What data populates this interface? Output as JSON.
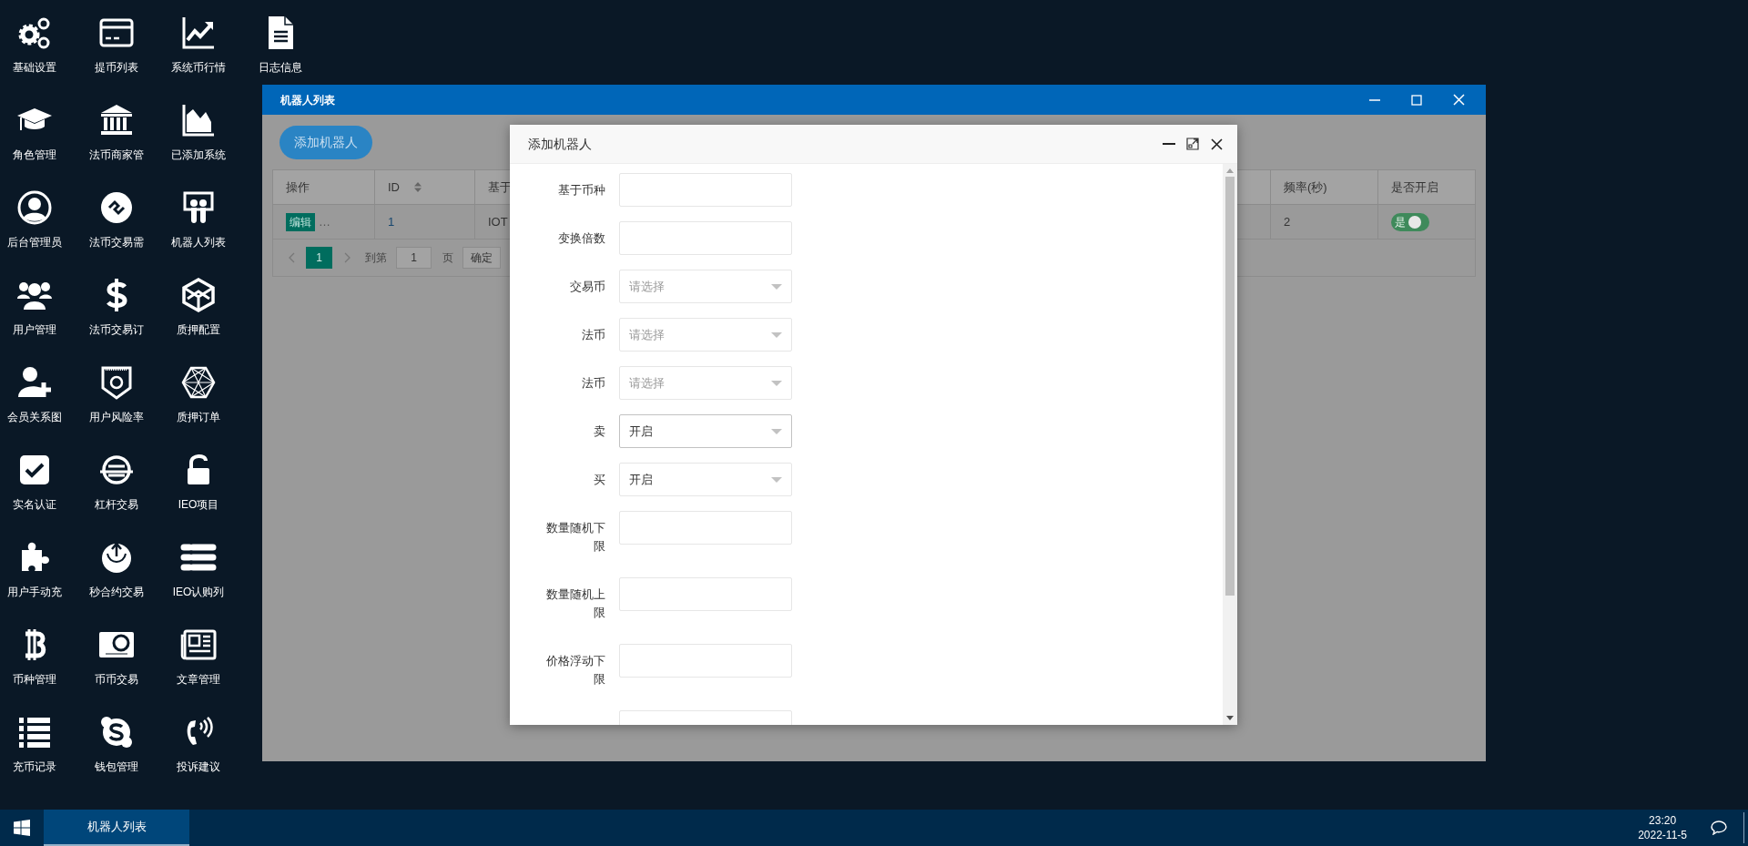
{
  "desktop_icons": [
    {
      "label": "基础设置"
    },
    {
      "label": "角色管理"
    },
    {
      "label": "后台管理员"
    },
    {
      "label": "用户管理"
    },
    {
      "label": "会员关系图"
    },
    {
      "label": "实名认证"
    },
    {
      "label": "用户手动充"
    },
    {
      "label": "币种管理"
    },
    {
      "label": "充币记录"
    },
    {
      "label": "提币列表"
    },
    {
      "label": "法币商家管"
    },
    {
      "label": "法币交易需"
    },
    {
      "label": "法币交易订"
    },
    {
      "label": "用户风险率"
    },
    {
      "label": "杠杆交易"
    },
    {
      "label": "秒合约交易"
    },
    {
      "label": "币币交易"
    },
    {
      "label": "钱包管理"
    },
    {
      "label": "系统币行情"
    },
    {
      "label": "已添加系统"
    },
    {
      "label": "机器人列表"
    },
    {
      "label": "质押配置"
    },
    {
      "label": "质押订单"
    },
    {
      "label": "IEO项目"
    },
    {
      "label": "IEO认购列"
    },
    {
      "label": "文章管理"
    },
    {
      "label": "投诉建议"
    },
    {
      "label": "日志信息"
    }
  ],
  "window": {
    "title": "机器人列表",
    "add_button": "添加机器人",
    "table": {
      "columns": [
        {
          "label": "操作",
          "sortable": false
        },
        {
          "label": "ID",
          "sortable": true
        },
        {
          "label": "基于",
          "sortable": false
        },
        {
          "label": "频率(秒)",
          "sortable": false
        },
        {
          "label": "是否开启",
          "sortable": false
        }
      ],
      "rows": [
        {
          "action": "编辑",
          "more": "…",
          "id": "1",
          "column_3": "IOT",
          "frequency": "2",
          "enabled": true,
          "enabled_label": "是"
        }
      ]
    },
    "pagination": {
      "pages": [
        {
          "label": "1",
          "selected": true
        }
      ],
      "goto_label": "到第",
      "goto_value": "1",
      "page_unit": "页",
      "confirm": "确定"
    }
  },
  "dialog": {
    "title": "添加机器人",
    "fields": [
      {
        "kind": "input",
        "label": "基于币种"
      },
      {
        "kind": "input",
        "label": "变换倍数"
      },
      {
        "kind": "select",
        "label": "交易币",
        "placeholder": "请选择",
        "focused": false
      },
      {
        "kind": "select",
        "label": "法币",
        "placeholder": "请选择",
        "focused": false
      },
      {
        "kind": "select",
        "label": "法币",
        "placeholder": "请选择",
        "focused": false
      },
      {
        "kind": "select",
        "label": "卖",
        "value": "开启",
        "focused": true
      },
      {
        "kind": "select",
        "label": "买",
        "value": "开启",
        "focused": false
      },
      {
        "kind": "input",
        "label": "数量随机下限"
      },
      {
        "kind": "input",
        "label": "数量随机上限"
      },
      {
        "kind": "input",
        "label": "价格浮动下限"
      },
      {
        "kind": "input"
      }
    ]
  },
  "taskbar": {
    "tasks": [
      {
        "label": "机器人列表",
        "selected": true
      }
    ],
    "time": "23:20",
    "date": "2022-11-5"
  }
}
